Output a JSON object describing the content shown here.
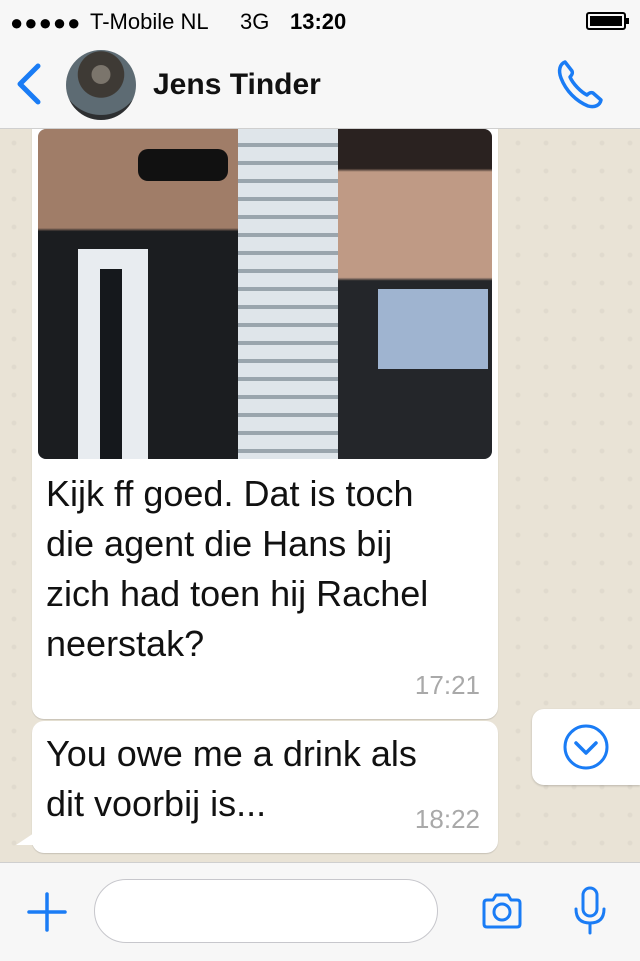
{
  "status_bar": {
    "signal": "●●●●●",
    "carrier": "T-Mobile NL",
    "network": "3G",
    "time": "13:20"
  },
  "header": {
    "back_icon": "chevron-left-icon",
    "contact_name": "Jens Tinder",
    "call_icon": "phone-icon"
  },
  "messages": [
    {
      "type": "image-with-caption",
      "text": "Kijk ff goed. Dat is toch\ndie agent die Hans bij\nzich had toen hij Rachel\nneerstak?",
      "time": "17:21"
    },
    {
      "type": "text",
      "text": "You owe me a drink als\ndit voorbij is...",
      "time": "18:22"
    }
  ],
  "composer": {
    "plus_icon": "plus-icon",
    "input_value": "",
    "camera_icon": "camera-icon",
    "mic_icon": "microphone-icon"
  },
  "colors": {
    "accent": "#1a7cf5",
    "chat_background": "#e9e3d6",
    "bubble": "#ffffff",
    "timestamp": "#a9a9a9"
  }
}
